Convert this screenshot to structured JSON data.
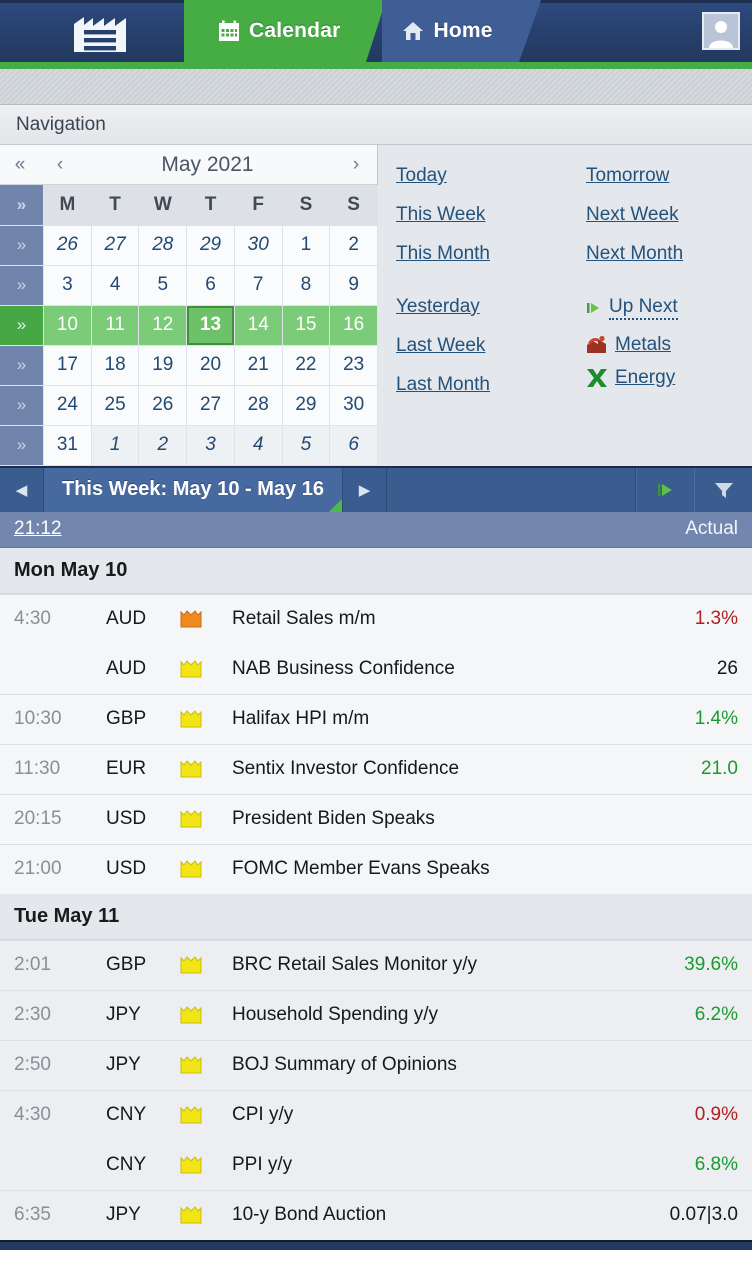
{
  "header": {
    "brand_icon": "factory-logo-icon",
    "tabs": [
      {
        "label": "Calendar",
        "icon": "calendar-icon",
        "active": true
      },
      {
        "label": "Home",
        "icon": "house-icon",
        "active": false
      }
    ],
    "avatar_icon": "user-avatar-icon",
    "accent_green": "#45ad44",
    "nav_blue": "#27406e"
  },
  "navigation": {
    "title": "Navigation",
    "calendar": {
      "month_label": "May 2021",
      "prev_year_icon": "double-chevron-left-icon",
      "prev_month_icon": "chevron-left-icon",
      "next_month_icon": "chevron-right-icon",
      "week_col_icon": "double-chevron-down-icon",
      "week_row_icon": "double-chevron-right-icon",
      "daynames": [
        "M",
        "T",
        "W",
        "T",
        "F",
        "S",
        "S"
      ],
      "weeks": [
        {
          "days": [
            "26",
            "27",
            "28",
            "29",
            "30",
            "1",
            "2"
          ],
          "other": [
            true,
            true,
            true,
            true,
            true,
            false,
            false
          ],
          "selected": false
        },
        {
          "days": [
            "3",
            "4",
            "5",
            "6",
            "7",
            "8",
            "9"
          ],
          "other": [
            false,
            false,
            false,
            false,
            false,
            false,
            false
          ],
          "selected": false
        },
        {
          "days": [
            "10",
            "11",
            "12",
            "13",
            "14",
            "15",
            "16"
          ],
          "other": [
            false,
            false,
            false,
            false,
            false,
            false,
            false
          ],
          "selected": true,
          "today_index": 3
        },
        {
          "days": [
            "17",
            "18",
            "19",
            "20",
            "21",
            "22",
            "23"
          ],
          "other": [
            false,
            false,
            false,
            false,
            false,
            false,
            false
          ],
          "selected": false
        },
        {
          "days": [
            "24",
            "25",
            "26",
            "27",
            "28",
            "29",
            "30"
          ],
          "other": [
            false,
            false,
            false,
            false,
            false,
            false,
            false
          ],
          "selected": false
        },
        {
          "days": [
            "31",
            "1",
            "2",
            "3",
            "4",
            "5",
            "6"
          ],
          "other": [
            false,
            true,
            true,
            true,
            true,
            true,
            true
          ],
          "selected": false
        }
      ]
    },
    "links_left": [
      "Today",
      "This Week",
      "This Month",
      "Yesterday",
      "Last Week",
      "Last Month"
    ],
    "links_right": [
      "Tomorrow",
      "Next Week",
      "Next Month"
    ],
    "icon_links": [
      {
        "label": "Up Next",
        "icon": "green-play-icon"
      },
      {
        "label": "Metals",
        "icon": "metals-icon"
      },
      {
        "label": "Energy",
        "icon": "energy-icon"
      }
    ]
  },
  "weekbar": {
    "prev_icon": "triangle-left-icon",
    "title": "This Week: May 10 - May 16",
    "next_icon": "triangle-right-icon",
    "play_icon": "green-play-icon",
    "filter_icon": "filter-funnel-icon",
    "time": "21:12",
    "actual_header": "Actual"
  },
  "days": [
    {
      "label": "Mon May 10",
      "events": [
        {
          "time": "4:30",
          "currency": "AUD",
          "impact": "medium",
          "title": "Retail Sales m/m",
          "actual": "1.3%",
          "actual_color": "red"
        },
        {
          "time": "",
          "currency": "AUD",
          "impact": "low",
          "title": "NAB Business Confidence",
          "actual": "26",
          "actual_color": "black"
        },
        {
          "time": "10:30",
          "currency": "GBP",
          "impact": "low",
          "title": "Halifax HPI m/m",
          "actual": "1.4%",
          "actual_color": "green"
        },
        {
          "time": "11:30",
          "currency": "EUR",
          "impact": "low",
          "title": "Sentix Investor Confidence",
          "actual": "21.0",
          "actual_color": "green"
        },
        {
          "time": "20:15",
          "currency": "USD",
          "impact": "low",
          "title": "President Biden Speaks",
          "actual": "",
          "actual_color": "black"
        },
        {
          "time": "21:00",
          "currency": "USD",
          "impact": "low",
          "title": "FOMC Member Evans Speaks",
          "actual": "",
          "actual_color": "black"
        }
      ]
    },
    {
      "label": "Tue May 11",
      "events": [
        {
          "time": "2:01",
          "currency": "GBP",
          "impact": "low",
          "title": "BRC Retail Sales Monitor y/y",
          "actual": "39.6%",
          "actual_color": "green"
        },
        {
          "time": "2:30",
          "currency": "JPY",
          "impact": "low",
          "title": "Household Spending y/y",
          "actual": "6.2%",
          "actual_color": "green"
        },
        {
          "time": "2:50",
          "currency": "JPY",
          "impact": "low",
          "title": "BOJ Summary of Opinions",
          "actual": "",
          "actual_color": "black"
        },
        {
          "time": "4:30",
          "currency": "CNY",
          "impact": "low",
          "title": "CPI y/y",
          "actual": "0.9%",
          "actual_color": "red"
        },
        {
          "time": "",
          "currency": "CNY",
          "impact": "low",
          "title": "PPI y/y",
          "actual": "6.8%",
          "actual_color": "green"
        },
        {
          "time": "6:35",
          "currency": "JPY",
          "impact": "low",
          "title": "10-y Bond Auction",
          "actual": "0.07|3.0",
          "actual_color": "black"
        }
      ]
    }
  ],
  "colors": {
    "impact_medium": "#f08a20",
    "impact_low": "#f2e516",
    "actual_red": "#b02020",
    "actual_green": "#1a9b2f",
    "week_highlight": "#7ccb78"
  }
}
